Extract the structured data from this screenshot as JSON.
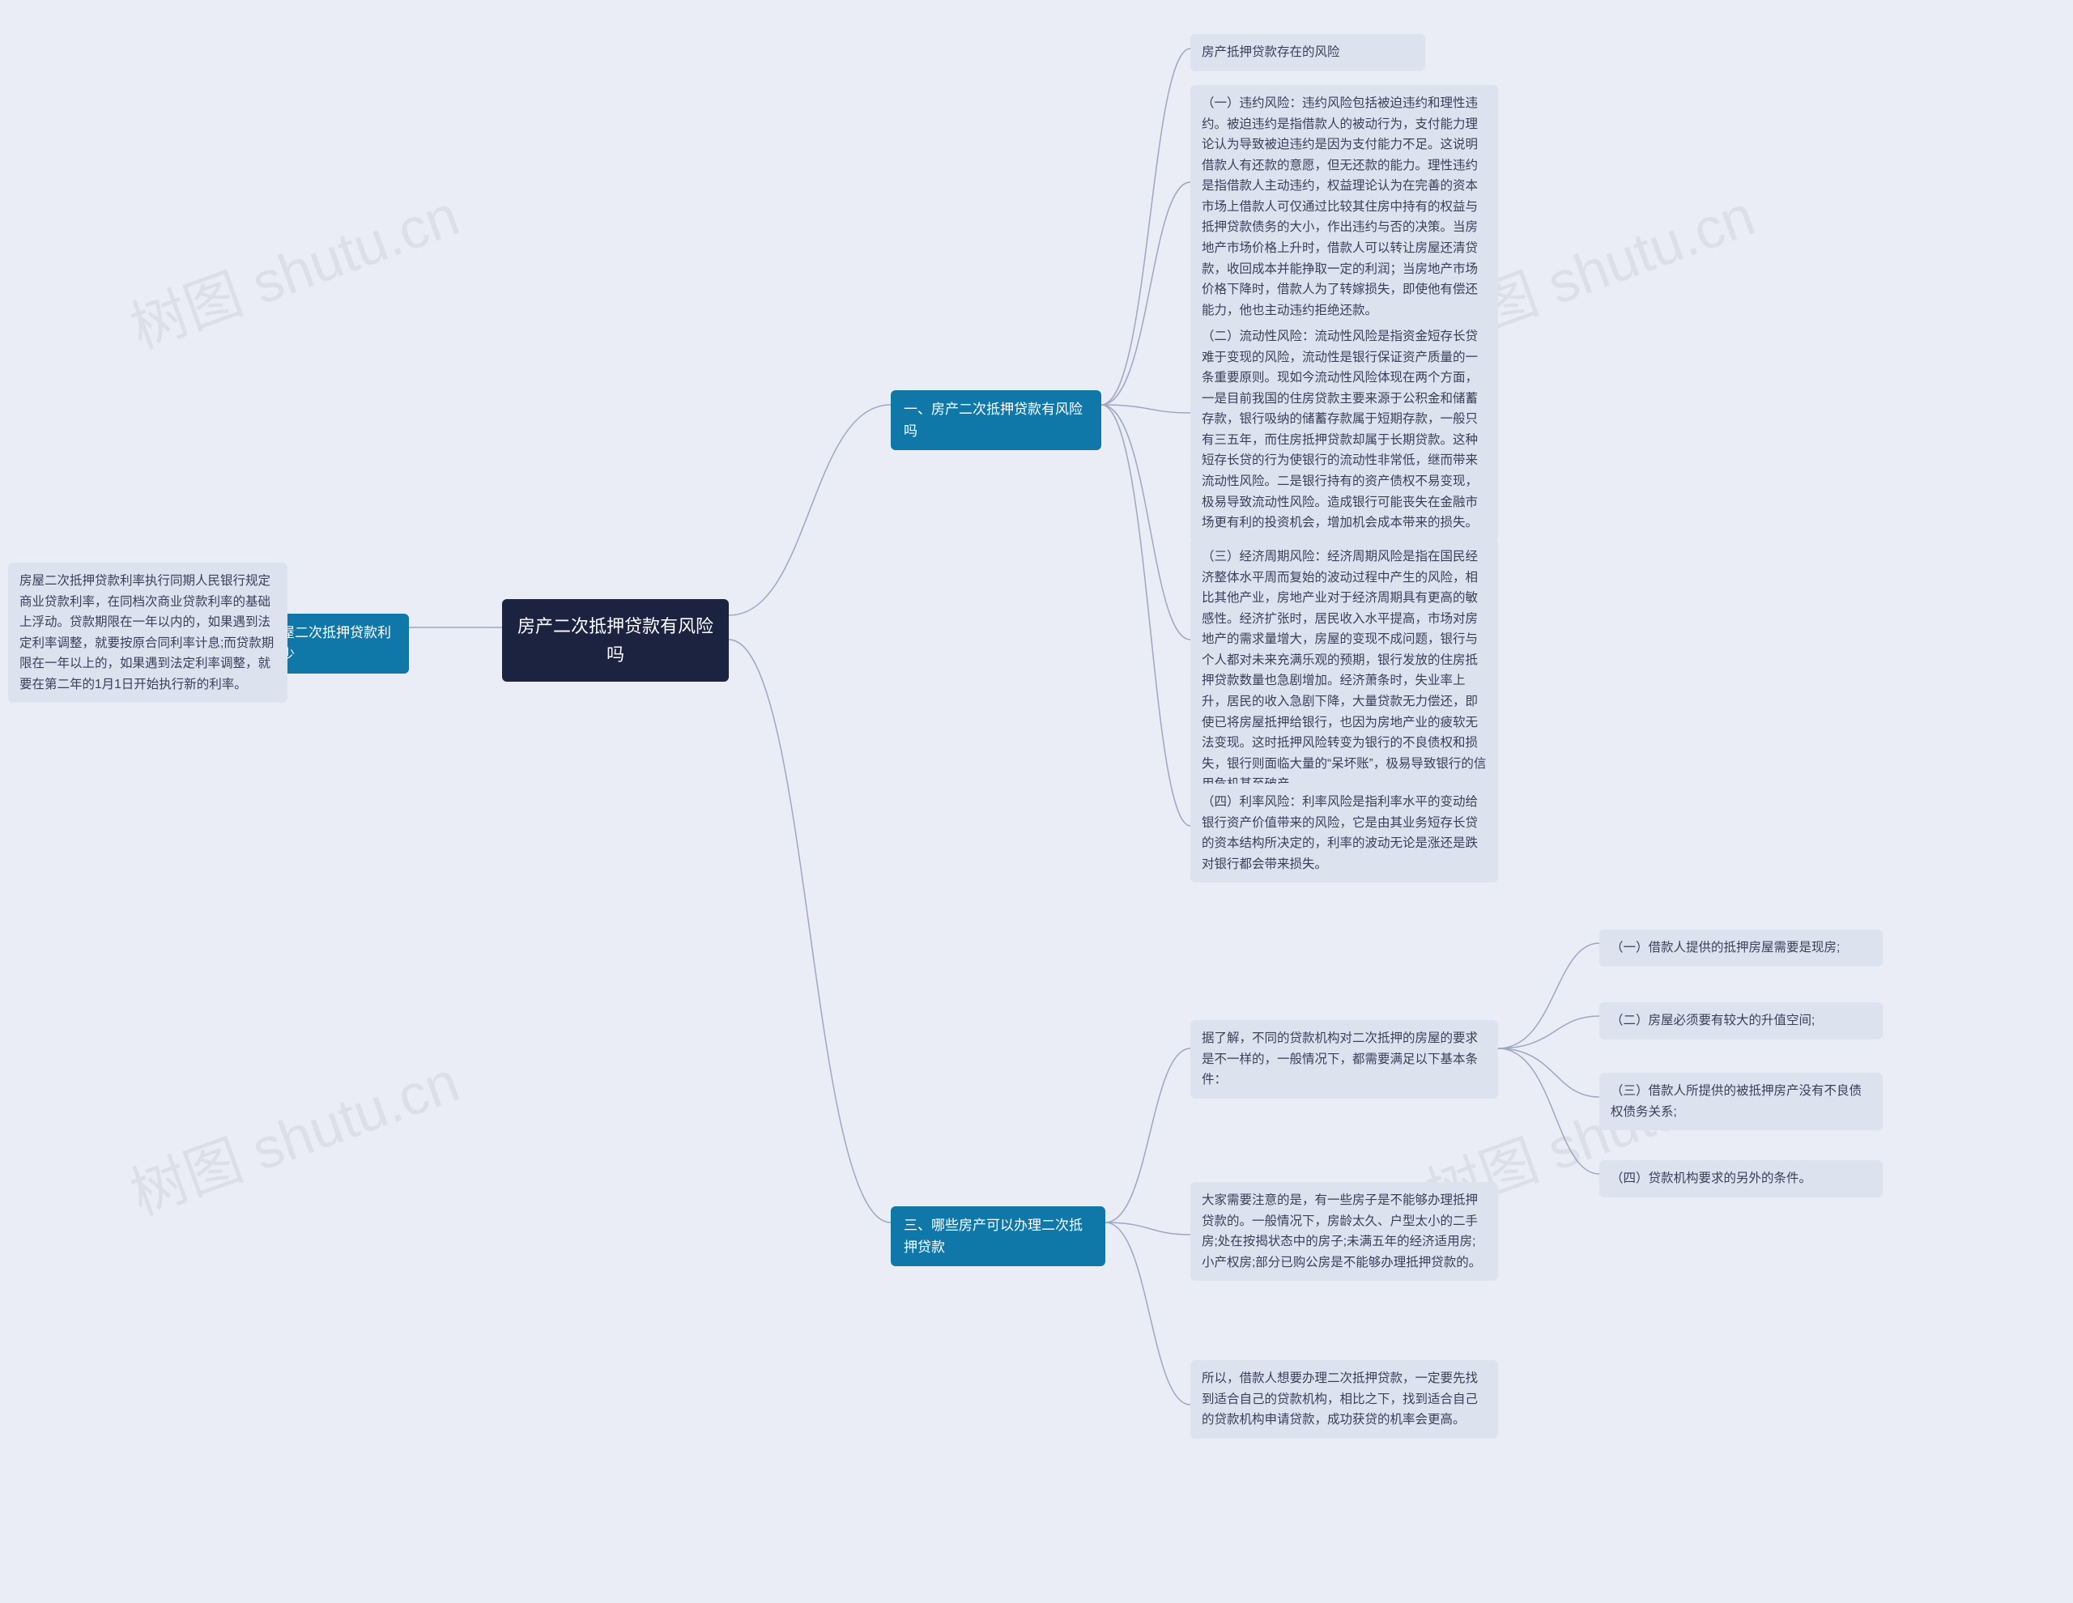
{
  "root": {
    "title": "房产二次抵押贷款有风险吗"
  },
  "branches": {
    "b1": {
      "label": "一、房产二次抵押贷款有风险吗"
    },
    "b2": {
      "label": "二、房屋二次抵押贷款利率是多少"
    },
    "b3": {
      "label": "三、哪些房产可以办理二次抵押贷款"
    }
  },
  "leaves": {
    "b1_0": "房产抵押贷款存在的风险",
    "b1_1": "（一）违约风险：违约风险包括被迫违约和理性违约。被迫违约是指借款人的被动行为，支付能力理论认为导致被迫违约是因为支付能力不足。这说明借款人有还款的意愿，但无还款的能力。理性违约是指借款人主动违约，权益理论认为在完善的资本市场上借款人可仅通过比较其住房中持有的权益与抵押贷款债务的大小，作出违约与否的决策。当房地产市场价格上升时，借款人可以转让房屋还清贷款，收回成本并能挣取一定的利润；当房地产市场价格下降时，借款人为了转嫁损失，即使他有偿还能力，他也主动违约拒绝还款。",
    "b1_2": "（二）流动性风险：流动性风险是指资金短存长贷难于变现的风险，流动性是银行保证资产质量的一条重要原则。现如今流动性风险体现在两个方面，一是目前我国的住房贷款主要来源于公积金和储蓄存款，银行吸纳的储蓄存款属于短期存款，一般只有三五年，而住房抵押贷款却属于长期贷款。这种短存长贷的行为使银行的流动性非常低，继而带来流动性风险。二是银行持有的资产债权不易变现，极易导致流动性风险。造成银行可能丧失在金融市场更有利的投资机会，增加机会成本带来的损失。",
    "b1_3": "（三）经济周期风险：经济周期风险是指在国民经济整体水平周而复始的波动过程中产生的风险，相比其他产业，房地产业对于经济周期具有更高的敏感性。经济扩张时，居民收入水平提高，市场对房地产的需求量增大，房屋的变现不成问题，银行与个人都对未来充满乐观的预期，银行发放的住房抵押贷款数量也急剧增加。经济萧条时，失业率上升，居民的收入急剧下降，大量贷款无力偿还，即使已将房屋抵押给银行，也因为房地产业的疲软无法变现。这时抵押风险转变为银行的不良债权和损失，银行则面临大量的“呆坏账”，极易导致银行的信用危机甚至破产。",
    "b1_4": "（四）利率风险：利率风险是指利率水平的变动给银行资产价值带来的风险，它是由其业务短存长贷的资本结构所决定的，利率的波动无论是涨还是跌对银行都会带来损失。",
    "b2_1": "房屋二次抵押贷款利率执行同期人民银行规定商业贷款利率，在同档次商业贷款利率的基础上浮动。贷款期限在一年以内的，如果遇到法定利率调整，就要按原合同利率计息;而贷款期限在一年以上的，如果遇到法定利率调整，就要在第二年的1月1日开始执行新的利率。",
    "b3_1": "据了解，不同的贷款机构对二次抵押的房屋的要求是不一样的，一般情况下，都需要满足以下基本条件：",
    "b3_2": "大家需要注意的是，有一些房子是不能够办理抵押贷款的。一般情况下，房龄太久、户型太小的二手房;处在按揭状态中的房子;未满五年的经济适用房;小产权房;部分已购公房是不能够办理抵押贷款的。",
    "b3_3": "所以，借款人想要办理二次抵押贷款，一定要先找到适合自己的贷款机构，相比之下，找到适合自己的贷款机构申请贷款，成功获贷的机率会更高。",
    "b3_1_1": "（一）借款人提供的抵押房屋需要是现房;",
    "b3_1_2": "（二）房屋必须要有较大的升值空间;",
    "b3_1_3": "（三）借款人所提供的被抵押房产没有不良债权债务关系;",
    "b3_1_4": "（四）贷款机构要求的另外的条件。"
  },
  "watermarks": {
    "text": "树图 shutu.cn"
  }
}
